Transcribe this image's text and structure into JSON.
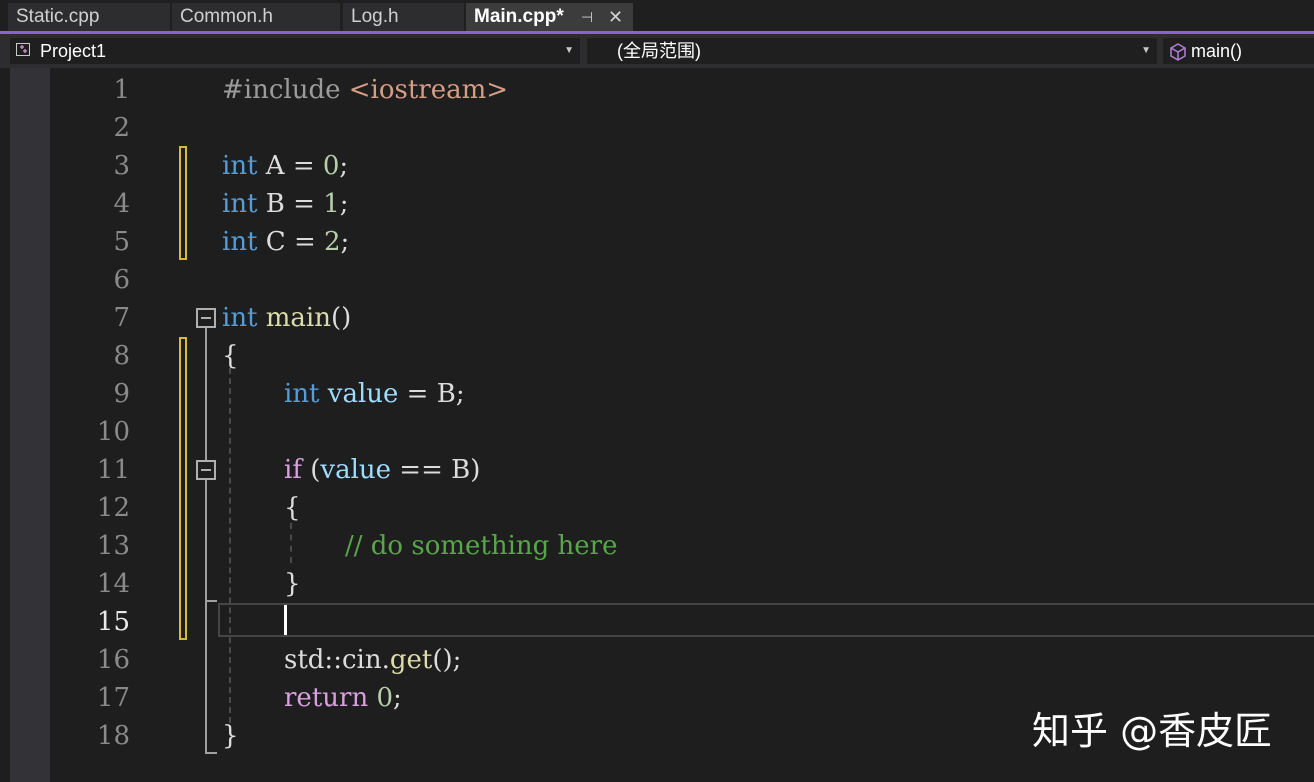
{
  "tabs": [
    {
      "label": "Static.cpp"
    },
    {
      "label": "Common.h"
    },
    {
      "label": "Log.h"
    },
    {
      "label": "Main.cpp*",
      "active": true
    }
  ],
  "nav": {
    "project": "Project1",
    "scope": "(全局范围)",
    "member": "main()"
  },
  "editor": {
    "current_line": 15,
    "line_numbers": [
      "1",
      "2",
      "3",
      "4",
      "5",
      "6",
      "7",
      "8",
      "9",
      "10",
      "11",
      "12",
      "13",
      "14",
      "15",
      "16",
      "17",
      "18"
    ],
    "code": {
      "l1": {
        "directive": "#include ",
        "header": "<iostream>"
      },
      "l3": {
        "kw": "int",
        "rest": " A = ",
        "num": "0",
        "end": ";"
      },
      "l4": {
        "kw": "int",
        "rest": " B = ",
        "num": "1",
        "end": ";"
      },
      "l5": {
        "kw": "int",
        "rest": " C = ",
        "num": "2",
        "end": ";"
      },
      "l7": {
        "kw": "int",
        "fn": "main",
        "paren": "()"
      },
      "l8": {
        "text": "{"
      },
      "l9": {
        "kw": "int",
        "var": "value",
        "rest": " = B;"
      },
      "l11": {
        "kw": "if",
        "open": " (",
        "var": "value",
        "rest": " == B)"
      },
      "l12": {
        "text": "{"
      },
      "l13": {
        "comment": "// do something here"
      },
      "l14": {
        "text": "}"
      },
      "l16": {
        "ns": "std::cin.",
        "fn": "get",
        "rest": "();"
      },
      "l17": {
        "kw": "return",
        "num": "0",
        "end": ";"
      },
      "l18": {
        "text": "}"
      }
    }
  },
  "watermark": "知乎 @香皮匠",
  "colors": {
    "keyword": "#569cd6",
    "control": "#d8a0df",
    "function": "#dcdcaa",
    "variable": "#9cdcfe",
    "string": "#d69d85",
    "number": "#b5cea8",
    "comment": "#57a64a",
    "accent": "#8a63d2",
    "change_marker": "#d7ba3d"
  }
}
